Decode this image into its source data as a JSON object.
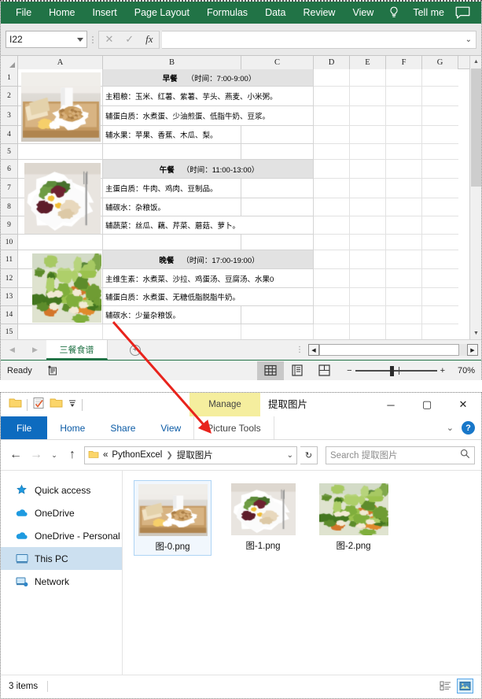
{
  "excel": {
    "ribbon_tabs": [
      "File",
      "Home",
      "Insert",
      "Page Layout",
      "Formulas",
      "Data",
      "Review",
      "View"
    ],
    "tell_me": "Tell me",
    "name_box": "I22",
    "formula_value": "",
    "col_headers": [
      "A",
      "B",
      "C",
      "D",
      "E",
      "F",
      "G"
    ],
    "row_headers": [
      "1",
      "2",
      "3",
      "4",
      "5",
      "6",
      "7",
      "8",
      "9",
      "10",
      "11",
      "12",
      "13",
      "14",
      "15"
    ],
    "cells": {
      "b1_title": "早餐",
      "b1_time": "（时间：7:00-9:00）",
      "b2": "主粗粮：玉米、红薯、紫薯、芋头、燕麦、小米粥。",
      "b3": "辅蛋白质：水煮蛋、少油煎蛋、低脂牛奶、豆浆。",
      "b4": "辅水果：苹果、香蕉、木瓜、梨。",
      "b6_title": "午餐",
      "b6_time": "（时间：11:00-13:00）",
      "b7": "主蛋白质：牛肉、鸡肉、豆制品。",
      "b8": "辅碳水：杂粮饭。",
      "b9": "辅蔬菜：丝瓜、藕、芹菜、蘑菇、萝卜。",
      "b11_title": "晚餐",
      "b11_time": "（时间：17:00-19:00）",
      "b12": "主维生素：水煮菜、沙拉、鸡蛋汤、豆腐汤、水果0",
      "b13": "辅蛋白质：水煮蛋、无糖低脂脱脂牛奶。",
      "b14": "辅碳水：少量杂粮饭。"
    },
    "sheet_tab": "三餐食谱",
    "status": "Ready",
    "zoom": "70%"
  },
  "explorer": {
    "title": "提取图片",
    "manage_tab": "Manage",
    "context_tab": "Picture Tools",
    "tabs": [
      "File",
      "Home",
      "Share",
      "View"
    ],
    "address": {
      "root": "«",
      "crumb1": "PythonExcel",
      "crumb2": "提取图片"
    },
    "search_placeholder": "Search 提取图片",
    "nav_items": [
      {
        "label": "Quick access",
        "icon": "star-icon"
      },
      {
        "label": "OneDrive",
        "icon": "cloud-icon"
      },
      {
        "label": "OneDrive - Personal",
        "icon": "cloud-icon"
      },
      {
        "label": "This PC",
        "icon": "monitor-icon"
      },
      {
        "label": "Network",
        "icon": "network-icon"
      }
    ],
    "files": [
      {
        "name": "图-0.png",
        "thumb": "breakfast"
      },
      {
        "name": "图-1.png",
        "thumb": "lunch"
      },
      {
        "name": "图-2.png",
        "thumb": "dinner"
      }
    ],
    "status_items": "3 items"
  },
  "annotation": {
    "arrow_color": "#e8231c"
  }
}
